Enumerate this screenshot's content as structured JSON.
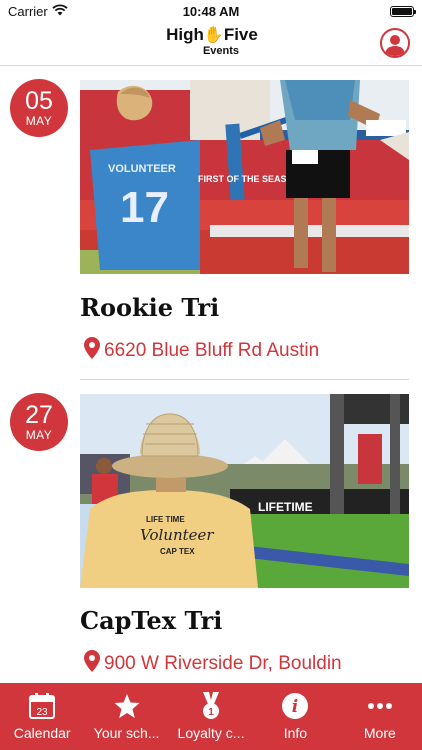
{
  "status_bar": {
    "carrier": "Carrier",
    "time": "10:48 AM"
  },
  "header": {
    "logo_line1": "High",
    "logo_line1b": "Five",
    "logo_line2": "Events"
  },
  "events": [
    {
      "day": "05",
      "month": "MAY",
      "title": "Rookie Tri",
      "address": "6620 Blue Bluff Rd Austin",
      "jersey_text": "VOLUNTEER",
      "jersey_number": "17",
      "banner_text": "FIRST OF THE SEASON"
    },
    {
      "day": "27",
      "month": "MAY",
      "title": "CapTex Tri",
      "address": "900 W Riverside Dr, Bouldin",
      "shirt_line1": "LIFE TIME",
      "shirt_line2": "Volunteer",
      "shirt_line3": "CAP TEX",
      "banner_text": "LIFETIME"
    }
  ],
  "tab_bar": {
    "tabs": [
      {
        "label": "Calendar",
        "icon": "calendar-icon",
        "icon_text": "23"
      },
      {
        "label": "Your sch...",
        "icon": "star-icon"
      },
      {
        "label": "Loyalty c...",
        "icon": "medal-icon",
        "icon_text": "1"
      },
      {
        "label": "Info",
        "icon": "info-icon",
        "icon_text": "i"
      },
      {
        "label": "More",
        "icon": "more-icon"
      }
    ]
  },
  "colors": {
    "accent": "#d0363b",
    "divider": "#d8d8d8",
    "text": "#111111"
  }
}
